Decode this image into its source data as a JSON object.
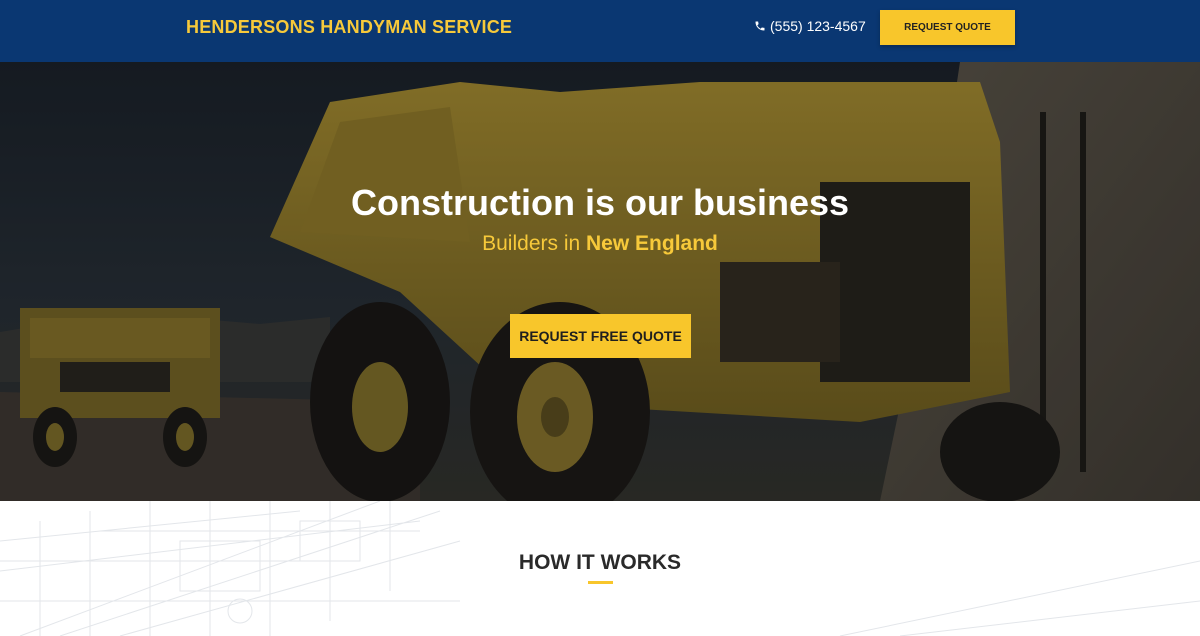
{
  "header": {
    "brand": "HENDERSONS HANDYMAN SERVICE",
    "phone_icon": "phone-icon",
    "phone": "(555) 123-4567",
    "cta_label": "REQUEST QUOTE"
  },
  "hero": {
    "title": "Construction is our business",
    "subtitle_prefix": "Builders in ",
    "subtitle_highlight": "New England",
    "cta_label": "REQUEST FREE QUOTE",
    "background_image": "yellow mining dump trucks"
  },
  "how_it_works": {
    "title": "HOW IT WORKS"
  },
  "colors": {
    "header_bg": "#0a3772",
    "accent": "#f8c62b",
    "brand_text": "#f7c93a"
  }
}
